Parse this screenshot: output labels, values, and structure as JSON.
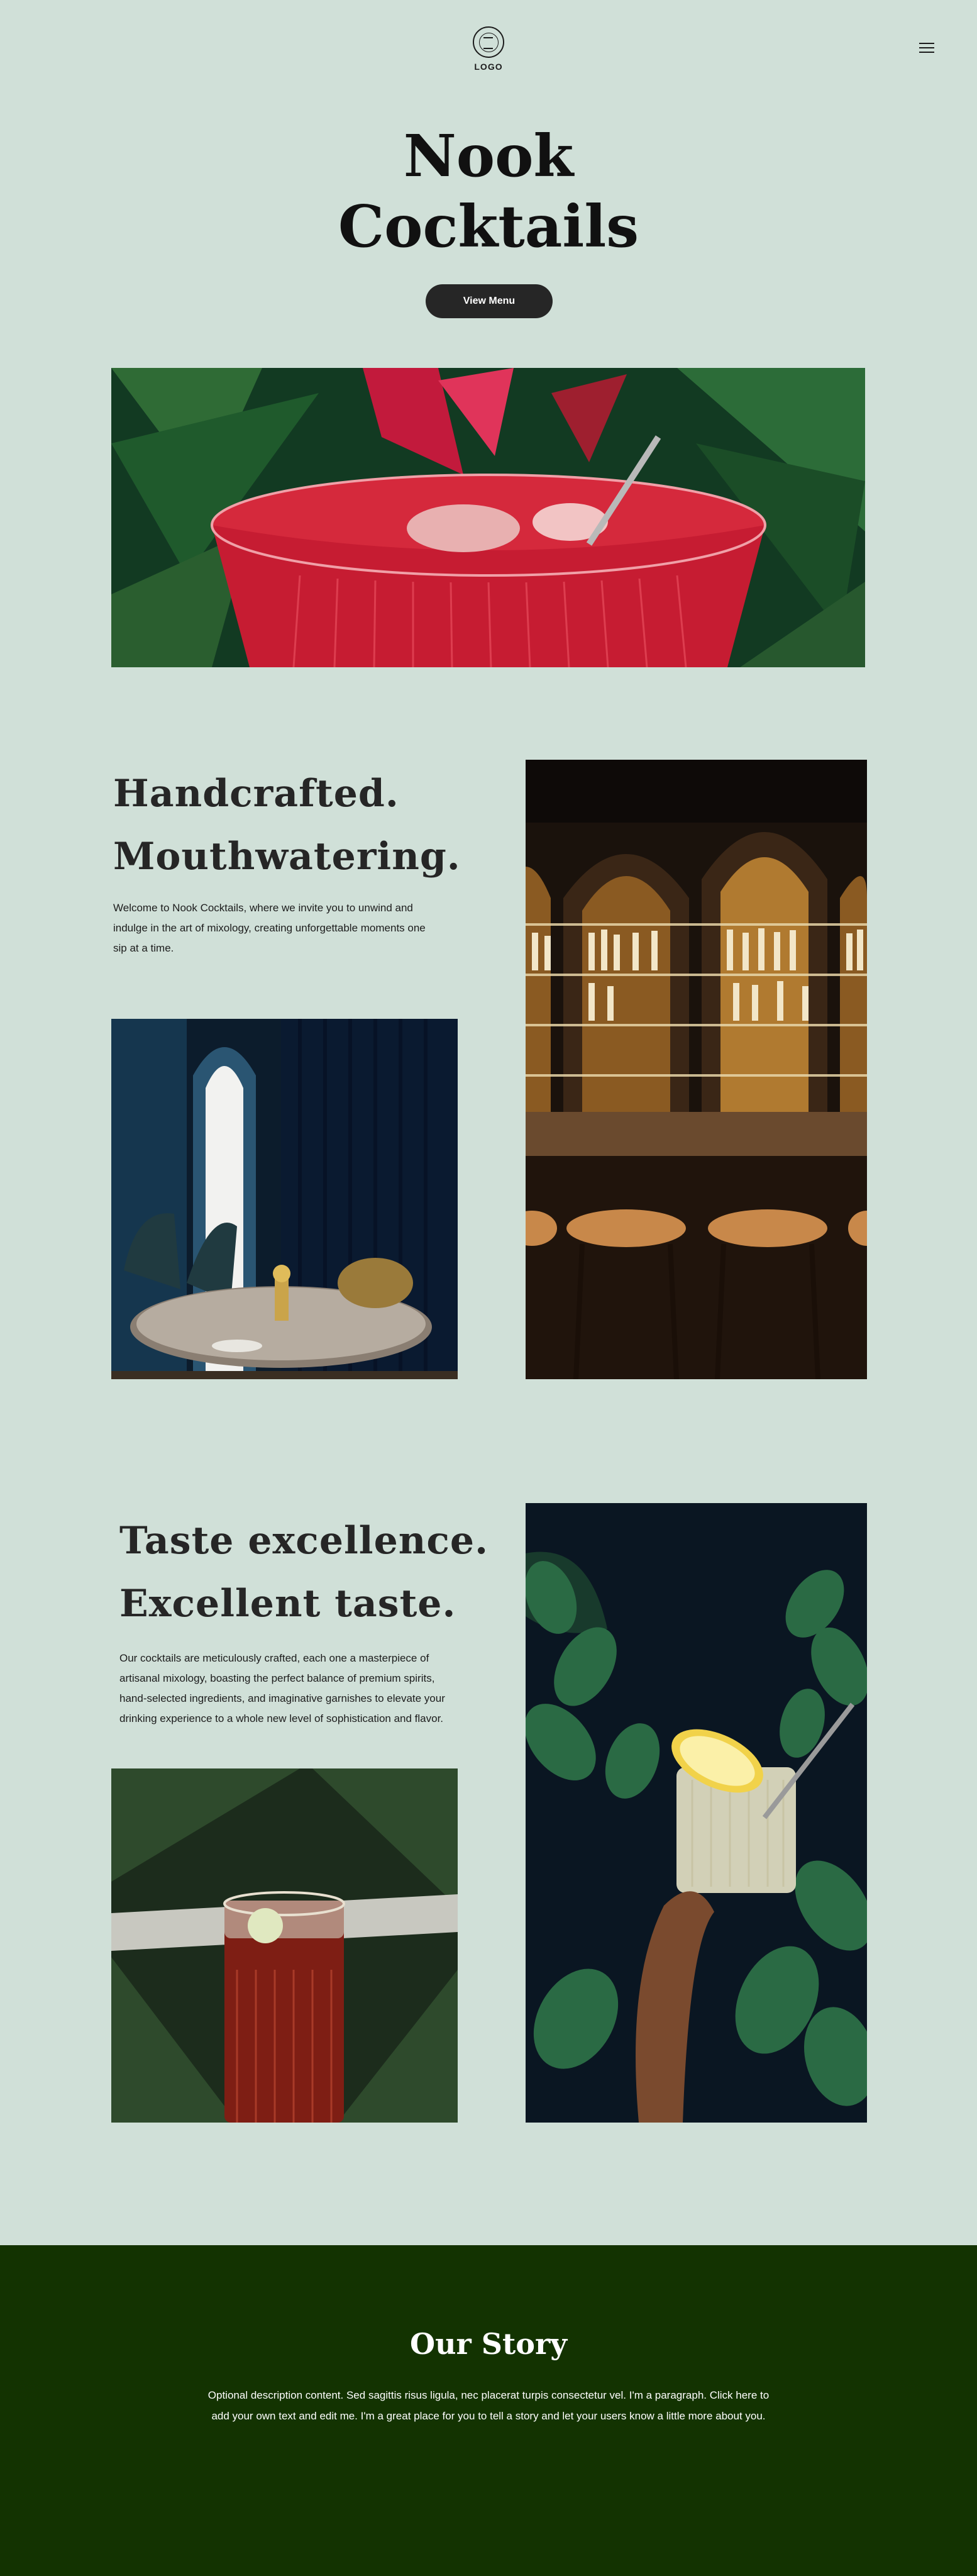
{
  "header": {
    "logo_label": "LOGO",
    "menu_icon": "hamburger-icon"
  },
  "hero": {
    "title_line1": "Nook",
    "title_line2": "Cocktails",
    "button_label": "View Menu"
  },
  "block1": {
    "title_line1": "Handcrafted.",
    "title_line2": "Mouthwatering.",
    "body": "Welcome to Nook Cocktails, where we invite you to unwind and indulge in the art of mixology, creating unforgettable moments one sip at a time."
  },
  "block2": {
    "title_line1": "Taste excellence.",
    "title_line2": "Excellent taste.",
    "body": "Our cocktails  are meticulously crafted, each one a masterpiece of artisanal mixology, boasting the perfect balance of premium spirits, hand-selected ingredients, and imaginative garnishes to elevate your drinking experience to a whole new level of sophistication and flavor."
  },
  "story": {
    "title": "Our Story",
    "body": "Optional description content. Sed sagittis risus ligula, nec placerat turpis consectetur vel. I'm a paragraph. Click here to add your own text and edit me. I'm a great place for you to tell a story and let your users know a little more about you."
  },
  "colors": {
    "background": "#d0e0d8",
    "button": "#262626",
    "story_background": "#133301",
    "text": "#1c1c1c"
  }
}
